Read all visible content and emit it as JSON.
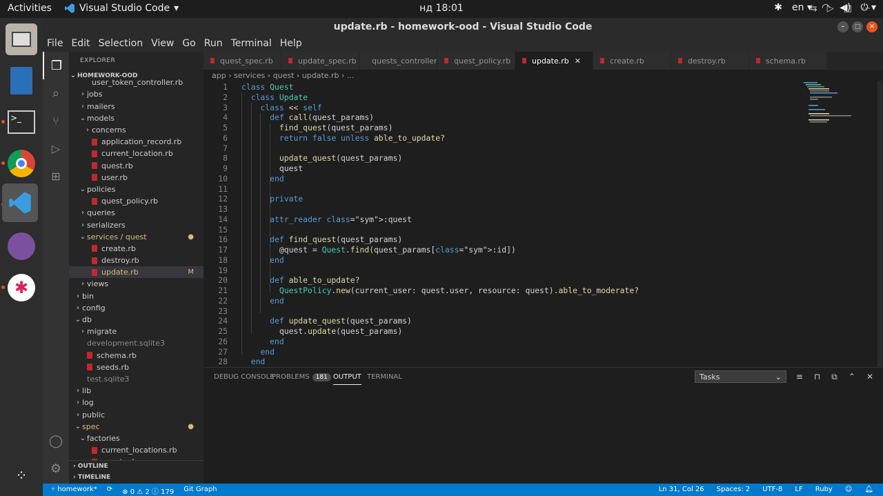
{
  "topbar": {
    "activities": "Activities",
    "app_name": "Visual Studio Code",
    "clock": "нд 18:01",
    "lang": "en"
  },
  "window": {
    "title": "update.rb - homework-ood - Visual Studio Code"
  },
  "menu": [
    "File",
    "Edit",
    "Selection",
    "View",
    "Go",
    "Run",
    "Terminal",
    "Help"
  ],
  "sidebar": {
    "header": "EXPLORER",
    "project": "HOMEWORK-OOD",
    "items": [
      {
        "label": "user_token_controller.rb",
        "indent": 3,
        "type": "file"
      },
      {
        "label": "jobs",
        "indent": 2,
        "type": "folder"
      },
      {
        "label": "mailers",
        "indent": 2,
        "type": "folder"
      },
      {
        "label": "models",
        "indent": 2,
        "type": "folder-open"
      },
      {
        "label": "concerns",
        "indent": 3,
        "type": "folder"
      },
      {
        "label": "application_record.rb",
        "indent": 3,
        "type": "rb"
      },
      {
        "label": "current_location.rb",
        "indent": 3,
        "type": "rb"
      },
      {
        "label": "quest.rb",
        "indent": 3,
        "type": "rb"
      },
      {
        "label": "user.rb",
        "indent": 3,
        "type": "rb"
      },
      {
        "label": "policies",
        "indent": 2,
        "type": "folder-open"
      },
      {
        "label": "quest_policy.rb",
        "indent": 3,
        "type": "rb"
      },
      {
        "label": "queries",
        "indent": 2,
        "type": "folder"
      },
      {
        "label": "serializers",
        "indent": 2,
        "type": "folder"
      },
      {
        "label": "services / quest",
        "indent": 2,
        "type": "folder-open",
        "mod": "●",
        "color": "#d7ba7d"
      },
      {
        "label": "create.rb",
        "indent": 3,
        "type": "rb"
      },
      {
        "label": "destroy.rb",
        "indent": 3,
        "type": "rb"
      },
      {
        "label": "update.rb",
        "indent": 3,
        "type": "rb",
        "selected": true,
        "mod": "M",
        "color": "#d7ba7d"
      },
      {
        "label": "views",
        "indent": 2,
        "type": "folder"
      },
      {
        "label": "bin",
        "indent": 1,
        "type": "folder"
      },
      {
        "label": "config",
        "indent": 1,
        "type": "folder"
      },
      {
        "label": "db",
        "indent": 1,
        "type": "folder-open"
      },
      {
        "label": "migrate",
        "indent": 2,
        "type": "folder"
      },
      {
        "label": "development.sqlite3",
        "indent": 2,
        "type": "file",
        "dim": true
      },
      {
        "label": "schema.rb",
        "indent": 2,
        "type": "rb"
      },
      {
        "label": "seeds.rb",
        "indent": 2,
        "type": "rb"
      },
      {
        "label": "test.sqlite3",
        "indent": 2,
        "type": "file",
        "dim": true
      },
      {
        "label": "lib",
        "indent": 1,
        "type": "folder"
      },
      {
        "label": "log",
        "indent": 1,
        "type": "folder"
      },
      {
        "label": "public",
        "indent": 1,
        "type": "folder"
      },
      {
        "label": "spec",
        "indent": 1,
        "type": "folder-open",
        "mod": "●",
        "color": "#d7ba7d"
      },
      {
        "label": "factories",
        "indent": 2,
        "type": "folder-open"
      },
      {
        "label": "current_locations.rb",
        "indent": 3,
        "type": "rb"
      },
      {
        "label": "quests.rb",
        "indent": 3,
        "type": "rb"
      }
    ],
    "outline": "OUTLINE",
    "timeline": "TIMELINE"
  },
  "tabs": [
    {
      "label": "quest_spec.rb"
    },
    {
      "label": "update_spec.rb"
    },
    {
      "label": "quests_controller.rb"
    },
    {
      "label": "quest_policy.rb"
    },
    {
      "label": "update.rb",
      "active": true
    },
    {
      "label": "create.rb"
    },
    {
      "label": "destroy.rb"
    },
    {
      "label": "schema.rb"
    }
  ],
  "breadcrumb": "app › services › quest › update.rb › ...",
  "code": [
    "class Quest",
    "  class Update",
    "    class << self",
    "      def call(quest_params)",
    "        find_quest(quest_params)",
    "        return false unless able_to_update?",
    "",
    "        update_quest(quest_params)",
    "        quest",
    "      end",
    "",
    "      private",
    "",
    "      attr_reader :quest",
    "",
    "      def find_quest(quest_params)",
    "        @quest = Quest.find(quest_params[:id])",
    "      end",
    "",
    "      def able_to_update?",
    "        QuestPolicy.new(current_user: quest.user, resource: quest).able_to_moderate?",
    "      end",
    "",
    "      def update_quest(quest_params)",
    "        quest.update(quest_params)",
    "      end",
    "    end",
    "  end"
  ],
  "panel": {
    "tabs": [
      "DEBUG CONSOLE",
      "PROBLEMS",
      "OUTPUT",
      "TERMINAL"
    ],
    "problems_count": "181",
    "active": "OUTPUT",
    "dropdown": "Tasks"
  },
  "status": {
    "branch": "homework*",
    "errors": "⊗ 0 ⚠ 2 ⓘ 179",
    "git": "Git Graph",
    "position": "Ln 31, Col 26",
    "spaces": "Spaces: 2",
    "encoding": "UTF-8",
    "eol": "LF",
    "lang": "Ruby"
  },
  "colors": {
    "accent": "#007acc",
    "ruby": "#c0282c"
  }
}
